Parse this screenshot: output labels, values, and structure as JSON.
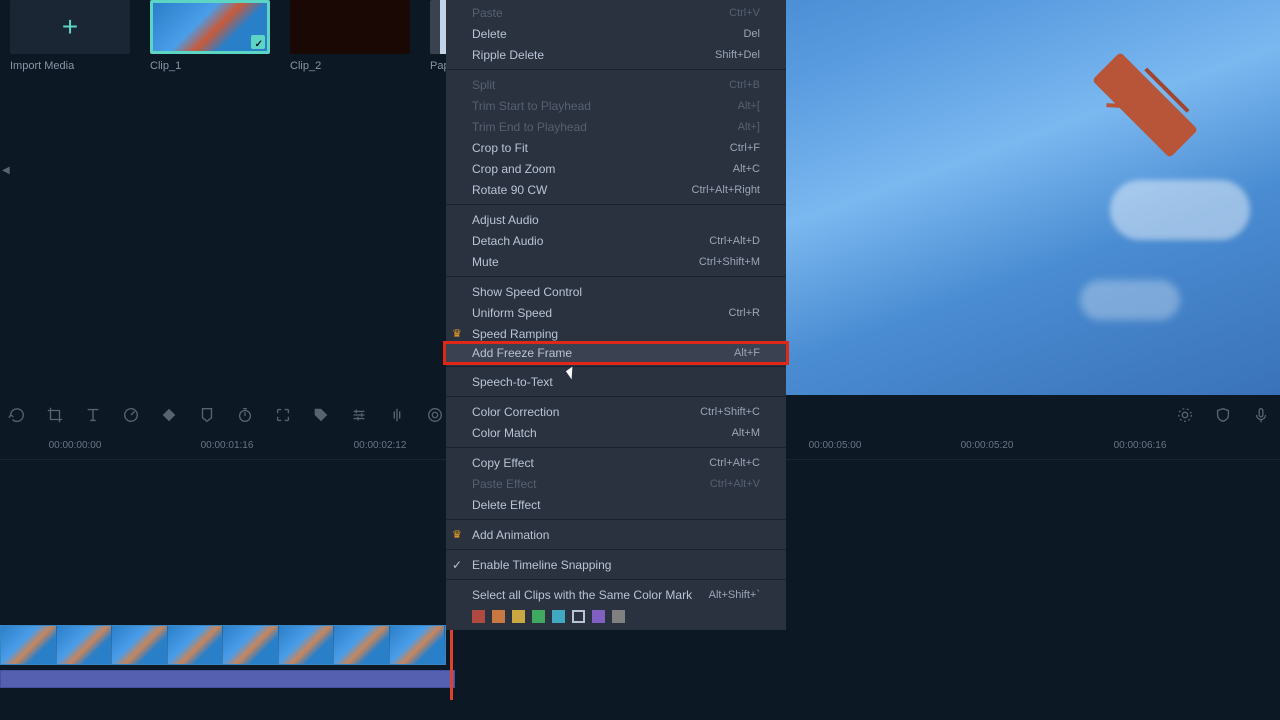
{
  "media": {
    "import_label": "Import Media",
    "clip1_label": "Clip_1",
    "clip2_label": "Clip_2",
    "pap_label": "Pap"
  },
  "context_menu": {
    "paste": {
      "label": "Paste",
      "shortcut": "Ctrl+V"
    },
    "delete": {
      "label": "Delete",
      "shortcut": "Del"
    },
    "ripple_delete": {
      "label": "Ripple Delete",
      "shortcut": "Shift+Del"
    },
    "split": {
      "label": "Split",
      "shortcut": "Ctrl+B"
    },
    "trim_start": {
      "label": "Trim Start to Playhead",
      "shortcut": "Alt+["
    },
    "trim_end": {
      "label": "Trim End to Playhead",
      "shortcut": "Alt+]"
    },
    "crop_fit": {
      "label": "Crop to Fit",
      "shortcut": "Ctrl+F"
    },
    "crop_zoom": {
      "label": "Crop and Zoom",
      "shortcut": "Alt+C"
    },
    "rotate": {
      "label": "Rotate 90 CW",
      "shortcut": "Ctrl+Alt+Right"
    },
    "adjust_audio": {
      "label": "Adjust Audio",
      "shortcut": ""
    },
    "detach_audio": {
      "label": "Detach Audio",
      "shortcut": "Ctrl+Alt+D"
    },
    "mute": {
      "label": "Mute",
      "shortcut": "Ctrl+Shift+M"
    },
    "show_speed": {
      "label": "Show Speed Control",
      "shortcut": ""
    },
    "uniform_speed": {
      "label": "Uniform Speed",
      "shortcut": "Ctrl+R"
    },
    "speed_ramping": {
      "label": "Speed Ramping",
      "shortcut": ""
    },
    "freeze_frame": {
      "label": "Add Freeze Frame",
      "shortcut": "Alt+F"
    },
    "speech_text": {
      "label": "Speech-to-Text",
      "shortcut": ""
    },
    "color_correction": {
      "label": "Color Correction",
      "shortcut": "Ctrl+Shift+C"
    },
    "color_match": {
      "label": "Color Match",
      "shortcut": "Alt+M"
    },
    "copy_effect": {
      "label": "Copy Effect",
      "shortcut": "Ctrl+Alt+C"
    },
    "paste_effect": {
      "label": "Paste Effect",
      "shortcut": "Ctrl+Alt+V"
    },
    "delete_effect": {
      "label": "Delete Effect",
      "shortcut": ""
    },
    "add_animation": {
      "label": "Add Animation",
      "shortcut": ""
    },
    "snapping": {
      "label": "Enable Timeline Snapping",
      "shortcut": ""
    },
    "select_color_mark": {
      "label": "Select all Clips with the Same Color Mark",
      "shortcut": "Alt+Shift+`"
    }
  },
  "color_marks": [
    "#b04a40",
    "#c87840",
    "#c8a840",
    "#40a860",
    "#40a8c0",
    "#4060c0",
    "#8060c0",
    "#808080"
  ],
  "timeline": {
    "marks": [
      "00:00:00:00",
      "00:00:01:16",
      "00:00:02:12",
      "00:00:05:00",
      "00:00:05:20",
      "00:00:06:16"
    ]
  }
}
